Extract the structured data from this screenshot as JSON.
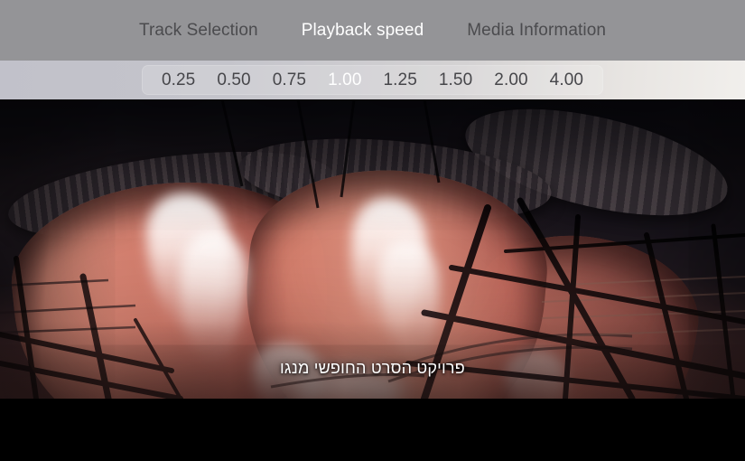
{
  "overlay": {
    "tabs": [
      {
        "label": "Track Selection",
        "selected": false
      },
      {
        "label": "Playback speed",
        "selected": true
      },
      {
        "label": "Media Information",
        "selected": false
      }
    ],
    "speed_options": [
      {
        "label": "0.25",
        "selected": false
      },
      {
        "label": "0.50",
        "selected": false
      },
      {
        "label": "0.75",
        "selected": false
      },
      {
        "label": "1.00",
        "selected": true
      },
      {
        "label": "1.25",
        "selected": false
      },
      {
        "label": "1.50",
        "selected": false
      },
      {
        "label": "2.00",
        "selected": false
      },
      {
        "label": "4.00",
        "selected": false
      }
    ],
    "colors": {
      "tab_bar_background": "#949497",
      "tab_text": "#4b4b4e",
      "tab_text_selected": "#ffffff",
      "speed_bar_left": "#c1c1ca",
      "speed_bar_right": "#f1efec",
      "speed_text": "#46464a",
      "speed_text_selected": "#ffffff"
    }
  },
  "video": {
    "subtitle": "פרויקט הסרט החופשי מנגו",
    "subtitle_color": "#ffffff",
    "letterbox_color": "#000000",
    "scene_colors": {
      "tank_salmon": "#d67c6c",
      "tank_highlight": "#e4927e",
      "steam_white": "#fffaf8",
      "structure_dark": "#241a1c",
      "ceiling_dark": "#12101a"
    }
  }
}
